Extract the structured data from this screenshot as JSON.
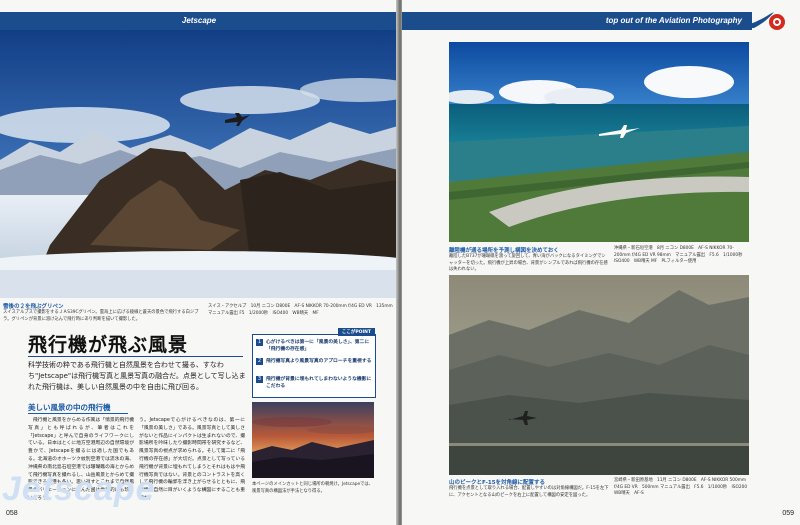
{
  "left_page": {
    "header": "Jetscape",
    "hero_caption": {
      "title": "雪後の２を飛ぶグリペン",
      "text": "スイスアルプスで撮影をするＪＡS39Cグリペン。雲海上に広げる稜線と蒼天の景色で飛行する白ジブラ。グリペンが背景に溶け込んで飛行時にあり判断を描いて撮影した。",
      "camera": "スイス・アクセルプ　10月 ニコン D800E　AF-S NIKKOR 70-200mm f/4G ED VR　135mm　マニュアル露出 F5　1/2000秒　ISO400　WB晴天　MF"
    },
    "point_label": "ここがPOINT",
    "title": "飛行機が飛ぶ風景",
    "lead": "科学技術の粋である飛行機と自然風景を合わせて撮る、すなわち\"Jetscape\"は飛行機写真と風景写真の融合だ。点景として写し込まれた飛行機は、美しい自然風景の中を自由に飛び回る。",
    "points": [
      {
        "num": "1",
        "text": "心がけるべきは第一に「風景の美しさ」、第二に「飛行機の存在感」"
      },
      {
        "num": "2",
        "text": "飛行機写真より風景写真のアプローチを重視する"
      },
      {
        "num": "3",
        "text": "飛行機が背景に埋もれてしまわないような機影にこだわる"
      }
    ],
    "section_heading": "美しい風景の中の飛行機",
    "body_col1": "　飛行機と風景をからめる作風は「情景的飛行機写真」とも呼ばれるが、筆者はこれを「Jetscape」と呼んで自身のライフワークにしている。日本はとくに地方空港周辺の自然環境が豊かで、Jetscapeを撮るには適した国でもある。北海道のオホーツク紋別空港では流氷の海、沖縄県の南北島石垣空港では珊瑚礁の海とからめて飛行機写真を撮れるし、山岳風景とからめて撮影できる空港も多い。思い返すとこれまで自然風景のバリエーションに富んだ国は世界的にも珍しいだろう。",
    "body_col2": "う。Jetscapeで心がけるべきなのは、第一に「風景の美しさ」である。風景写真として美しさがないと作品にインパクトは生まれないので、撮影場所を吟味したり撮影時間帯を研究するなど、風景写真の視点が求められる。そして第二に「飛行機の存在感」が大切だ。点景として写っている飛行機が背景に埋もれてしまうとそれはもはや飛行機写真ではない。背景とのコントラストを高くして飛行機の輪郭を浮き上がらせるとともに、飛行機に自然に目がいくような構図にすることも重要だ。",
    "small_photo_caption": "本ページのメインカットと同じ場所の朝焼け。Jetscapeでは、風景写真の構図法が手法となり得る。",
    "watermark": "Jetscape",
    "page_number": "058"
  },
  "right_page": {
    "header": "top out of the Aviation Photography",
    "photo1_caption": {
      "title": "離陸機が通る場所を予測し構図を決めておく",
      "text": "離陸したB737が珊瑚礁を渡って旋回して、青い海がバックになるタイミングでシャッターを切った。飛行機が上昇の場合、背景がシンプルであれば飛行機の存在感は失われない。",
      "camera": "沖縄県・新石垣空港　8月 ニコン D800E　AF-S NIKKOR 70-200mm f/4G ED VR 98mm　マニュアル露出　F5.6　1/1000秒　ISO400　WB晴天 MF　PLフィルター使用"
    },
    "photo2_caption": {
      "title": "山のピークとF-15を対角線に配置する",
      "text": "飛行機を点景として取り入れる場合、配置しやすいのは対角線構図だ。F-15を左下に、アクセントとなる山のピークを右上に配置して構図の安定を図った。",
      "camera": "宮崎県・新田原基地　11月 ニコン D800E　AF-S NIKKOR 500mm f/4G ED VR　500mm マニュアル露出　F5.6　1/1000秒　ISO200　WB晴天　AF-S"
    },
    "page_number": "059"
  },
  "colors": {
    "brand_blue": "#1b4d8c",
    "accent_red": "#d42a1e",
    "caption_blue": "#1b5aa8"
  }
}
